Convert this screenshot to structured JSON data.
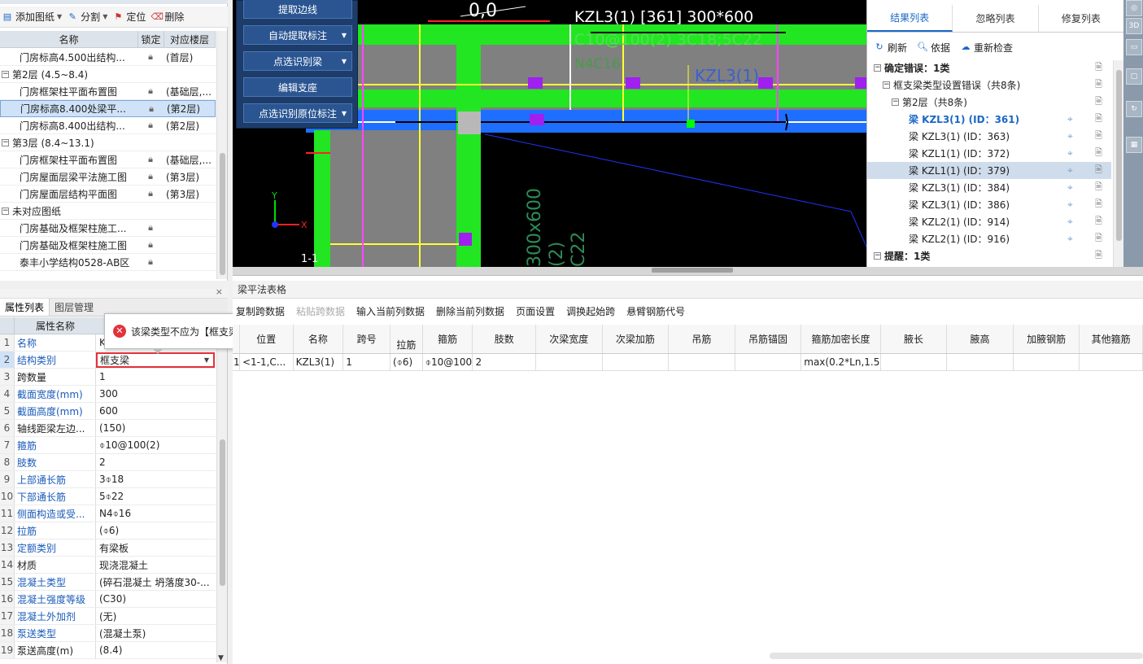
{
  "drawing_panel": {
    "toolbar": {
      "add_label": "添加图纸",
      "split_label": "分割",
      "locate_label": "定位",
      "delete_label": "删除"
    },
    "columns": {
      "name": "名称",
      "lock": "锁定",
      "floor": "对应楼层"
    },
    "rows": [
      {
        "indent": 2,
        "name": "门房标高4.500出结构...",
        "locked": true,
        "floor": "(首层)"
      },
      {
        "indent": 0,
        "group": true,
        "name": "第2层 (4.5~8.4)"
      },
      {
        "indent": 2,
        "name": "门房框架柱平面布置图",
        "locked": true,
        "floor": "(基础层,..."
      },
      {
        "indent": 2,
        "name": "门房标高8.400处梁平...",
        "locked": true,
        "floor": "(第2层)",
        "selected": true
      },
      {
        "indent": 2,
        "name": "门房标高8.400出结构...",
        "locked": true,
        "floor": "(第2层)"
      },
      {
        "indent": 0,
        "group": true,
        "name": "第3层 (8.4~13.1)"
      },
      {
        "indent": 2,
        "name": "门房框架柱平面布置图",
        "locked": true,
        "floor": "(基础层,..."
      },
      {
        "indent": 2,
        "name": "门房屋面层梁平法施工图",
        "locked": true,
        "floor": "(第3层)"
      },
      {
        "indent": 2,
        "name": "门房屋面层结构平面图",
        "locked": true,
        "floor": "(第3层)"
      },
      {
        "indent": 0,
        "group": true,
        "name": "未对应图纸"
      },
      {
        "indent": 2,
        "name": "门房基础及框架柱施工...",
        "locked": true,
        "floor": ""
      },
      {
        "indent": 2,
        "name": "门房基础及框架柱施工图",
        "locked": true,
        "floor": ""
      },
      {
        "indent": 2,
        "name": "泰丰小学结构0528-AB区",
        "locked": true,
        "floor": ""
      }
    ]
  },
  "cad_menu": {
    "buttons": [
      {
        "label": "提取边线",
        "dropdown": false
      },
      {
        "label": "自动提取标注",
        "dropdown": true
      },
      {
        "label": "点选识别梁",
        "dropdown": true
      },
      {
        "label": "编辑支座",
        "dropdown": false
      },
      {
        "label": "点选识别原位标注",
        "dropdown": true
      }
    ]
  },
  "cad_texts": {
    "beam_label": "KZL3(1) [361] 300*600",
    "stirrup": "C10@100(2) 3C18;5C22",
    "side": "N4C16",
    "beam_tag": "KZL3(1)",
    "top_num": "0,0",
    "vert1": "300x600",
    "vert2": "(2)",
    "vert3": "C22",
    "axis_y": "Y",
    "axis_x": "X",
    "grid": "1-1"
  },
  "results": {
    "tabs": [
      "结果列表",
      "忽略列表",
      "修复列表"
    ],
    "active_tab": 0,
    "tools": {
      "refresh": "刷新",
      "basis": "依据",
      "recheck": "重新检查"
    },
    "rows": [
      {
        "indent": 0,
        "text": "确定错误：1类",
        "bold": true,
        "expander": "−"
      },
      {
        "indent": 1,
        "text": "框支梁类型设置错误（共8条)",
        "expander": "−"
      },
      {
        "indent": 2,
        "text": "第2层（共8条)",
        "expander": "−"
      },
      {
        "indent": 3,
        "text": "梁 KZL3(1) (ID：361)",
        "current": true
      },
      {
        "indent": 3,
        "text": "梁 KZL3(1) (ID：363)"
      },
      {
        "indent": 3,
        "text": "梁 KZL1(1) (ID：372)"
      },
      {
        "indent": 3,
        "text": "梁 KZL1(1) (ID：379)",
        "selected": true
      },
      {
        "indent": 3,
        "text": "梁 KZL3(1) (ID：384)"
      },
      {
        "indent": 3,
        "text": "梁 KZL3(1) (ID：386)"
      },
      {
        "indent": 3,
        "text": "梁 KZL2(1) (ID：914)"
      },
      {
        "indent": 3,
        "text": "梁 KZL2(1) (ID：916)"
      },
      {
        "indent": 0,
        "text": "提醒：1类",
        "bold": true,
        "expander": "−"
      }
    ]
  },
  "properties": {
    "tabs": [
      "属性列表",
      "图层管理"
    ],
    "header_name": "属性名称",
    "rows": [
      {
        "no": "1",
        "name": "名称",
        "value": "K",
        "blue": true
      },
      {
        "no": "2",
        "name": "结构类别",
        "value": "框支梁",
        "blue": true,
        "boxed": true
      },
      {
        "no": "3",
        "name": "跨数量",
        "value": "1"
      },
      {
        "no": "4",
        "name": "截面宽度(mm)",
        "value": "300",
        "blue": true
      },
      {
        "no": "5",
        "name": "截面高度(mm)",
        "value": "600",
        "blue": true
      },
      {
        "no": "6",
        "name": "轴线距梁左边...",
        "value": "(150)"
      },
      {
        "no": "7",
        "name": "箍筋",
        "value": "⌽10@100(2)",
        "blue": true
      },
      {
        "no": "8",
        "name": "肢数",
        "value": "2",
        "blue": true
      },
      {
        "no": "9",
        "name": "上部通长筋",
        "value": "3⌽18",
        "blue": true
      },
      {
        "no": "10",
        "name": "下部通长筋",
        "value": "5⌽22",
        "blue": true
      },
      {
        "no": "11",
        "name": "侧面构造或受...",
        "value": "N4⌽16",
        "blue": true
      },
      {
        "no": "12",
        "name": "拉筋",
        "value": "(⌽6)",
        "blue": true
      },
      {
        "no": "13",
        "name": "定额类别",
        "value": "有梁板",
        "blue": true
      },
      {
        "no": "14",
        "name": "材质",
        "value": "现浇混凝土"
      },
      {
        "no": "15",
        "name": "混凝土类型",
        "value": "(碎石混凝土 坍落度30-...",
        "blue": true
      },
      {
        "no": "16",
        "name": "混凝土强度等级",
        "value": "(C30)",
        "blue": true
      },
      {
        "no": "17",
        "name": "混凝土外加剂",
        "value": "(无)",
        "blue": true
      },
      {
        "no": "18",
        "name": "泵送类型",
        "value": "(混凝土泵)",
        "blue": true
      },
      {
        "no": "19",
        "name": "泵送高度(m)",
        "value": "(8.4)"
      }
    ],
    "tooltip": "该梁类型不应为【框支梁】"
  },
  "beam_table": {
    "title": "梁平法表格",
    "tools": [
      {
        "label": "复制跨数据",
        "disabled": false
      },
      {
        "label": "粘贴跨数据",
        "disabled": true
      },
      {
        "label": "输入当前列数据",
        "disabled": false
      },
      {
        "label": "删除当前列数据",
        "disabled": false
      },
      {
        "label": "页面设置",
        "disabled": false
      },
      {
        "label": "调换起始跨",
        "disabled": false
      },
      {
        "label": "悬臂钢筋代号",
        "disabled": false
      }
    ],
    "columns": [
      "位置",
      "名称",
      "跨号",
      "拉筋",
      "箍筋",
      "肢数",
      "次梁宽度",
      "次梁加筋",
      "吊筋",
      "吊筋锚固",
      "箍筋加密长度",
      "腋长",
      "腋高",
      "加腋钢筋",
      "其他箍筋"
    ],
    "row_no": "1",
    "row": [
      "<1-1,C...",
      "KZL3(1)",
      "1",
      "(⌽6)",
      "⌽10@100",
      "2",
      "",
      "",
      "",
      "",
      "max(0.2*Ln,1.5...",
      "",
      "",
      "",
      ""
    ]
  },
  "colors": {
    "accent": "#1a67c7",
    "error": "#e2323a",
    "cad_green": "#22e622",
    "cad_gray": "#808080",
    "cad_blue": "#1e6fff"
  }
}
